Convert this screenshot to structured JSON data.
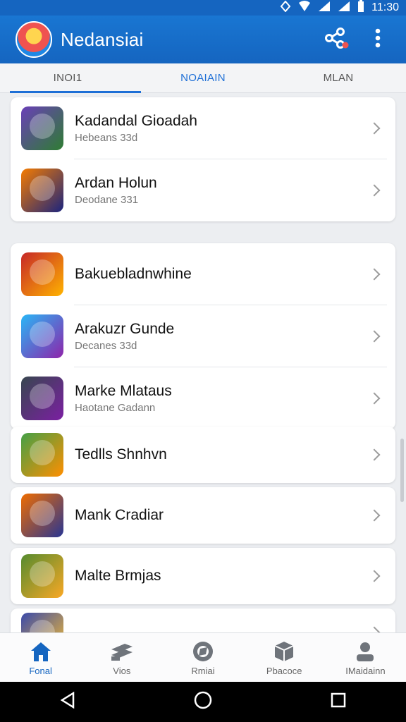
{
  "status_bar": {
    "time": "11:30"
  },
  "app": {
    "title": "Nedansiai"
  },
  "tabs": [
    {
      "label": "INOI1",
      "active": false
    },
    {
      "label": "NOAIAIN",
      "active": true
    },
    {
      "label": "MLAN",
      "active": false
    }
  ],
  "groups": [
    {
      "items": [
        {
          "title": "Kadandal Gioadah",
          "subtitle": "Hebeans 33d",
          "thumb_colors": [
            "#6a3fb8",
            "#2e7d32"
          ]
        },
        {
          "title": "Ardan Holun",
          "subtitle": "Deodane 331",
          "thumb_colors": [
            "#f57c00",
            "#1a237e"
          ]
        }
      ]
    },
    {
      "items": [
        {
          "title": "Bakuebladnwhine",
          "subtitle": "",
          "thumb_colors": [
            "#c62828",
            "#ffb300"
          ]
        },
        {
          "title": "Arakuzr Gunde",
          "subtitle": "Decanes 33d",
          "thumb_colors": [
            "#29b6f6",
            "#8e24aa"
          ]
        },
        {
          "title": "Marke Mlataus",
          "subtitle": "Haotane Gadann",
          "thumb_colors": [
            "#37474f",
            "#7b1fa2"
          ]
        }
      ]
    },
    {
      "items": [
        {
          "title": "Tedlls Shnhvn",
          "subtitle": "",
          "thumb_colors": [
            "#43a047",
            "#ff8f00"
          ]
        }
      ]
    },
    {
      "items": [
        {
          "title": "Mank Cradiar",
          "subtitle": "",
          "thumb_colors": [
            "#ef6c00",
            "#283593"
          ]
        }
      ]
    },
    {
      "items": [
        {
          "title": "Malte Brmjas",
          "subtitle": "",
          "thumb_colors": [
            "#558b2f",
            "#f9a825"
          ]
        }
      ]
    },
    {
      "items": [
        {
          "title": "",
          "subtitle": "",
          "thumb_colors": [
            "#3949ab",
            "#fbc02d"
          ]
        }
      ]
    }
  ],
  "bottom_nav": [
    {
      "label": "Fonal",
      "icon": "home-icon",
      "active": true
    },
    {
      "label": "Vios",
      "icon": "cards-icon",
      "active": false
    },
    {
      "label": "Rmiai",
      "icon": "globe-icon",
      "active": false
    },
    {
      "label": "Pbacoce",
      "icon": "box-icon",
      "active": false
    },
    {
      "label": "IMaidainn",
      "icon": "person-icon",
      "active": false
    }
  ],
  "colors": {
    "primary": "#1565c0",
    "accent": "#1e6fd6",
    "background": "#eceef1"
  }
}
